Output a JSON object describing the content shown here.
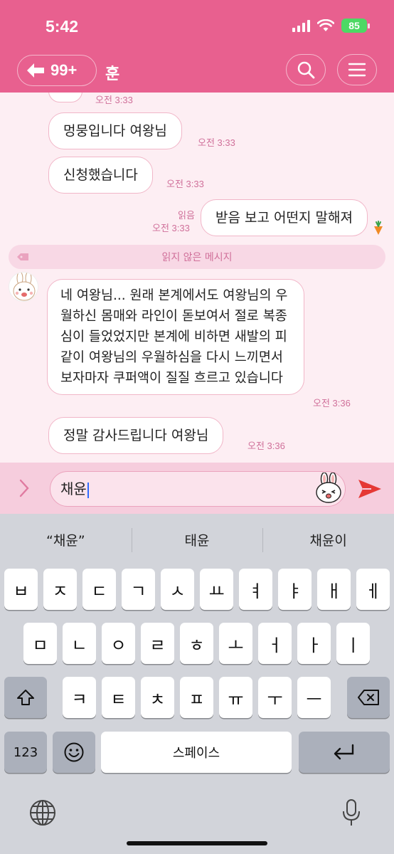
{
  "status": {
    "time": "5:42",
    "battery": "85"
  },
  "header": {
    "back_count": "99+",
    "title": "훈"
  },
  "messages": [
    {
      "text": "\"",
      "time": "오전 3:33"
    },
    {
      "text": "멍뭉입니다 여왕님",
      "time": "오전 3:33"
    },
    {
      "text": "신청했습니다",
      "time": "오전 3:33"
    },
    {
      "text": "받음 보고 어떤지 말해져",
      "time": "오전 3:33",
      "read": "읽음",
      "sender": "me"
    },
    {
      "text": "네 여왕님...  원래 본계에서도 여왕님의 우월하신 몸매와 라인이 돋보여서 절로 복종심이 들었었지만 본계에 비하면 새발의 피같이 여왕님의 우월하심을 다시 느끼면서 보자마자 쿠퍼액이 질질 흐르고 있습니다",
      "time": "오전 3:36"
    },
    {
      "text": "정말 감사드립니다 여왕님",
      "time": "오전 3:36"
    }
  ],
  "unread_label": "읽지 않은 메시지",
  "input": {
    "value": "채윤"
  },
  "suggestions": [
    "“채윤”",
    "태윤",
    "채윤이"
  ],
  "keyboard": {
    "row1": [
      "ㅂ",
      "ㅈ",
      "ㄷ",
      "ㄱ",
      "ㅅ",
      "ㅛ",
      "ㅕ",
      "ㅑ",
      "ㅐ",
      "ㅔ"
    ],
    "row2": [
      "ㅁ",
      "ㄴ",
      "ㅇ",
      "ㄹ",
      "ㅎ",
      "ㅗ",
      "ㅓ",
      "ㅏ",
      "ㅣ"
    ],
    "row3": [
      "ㅋ",
      "ㅌ",
      "ㅊ",
      "ㅍ",
      "ㅠ",
      "ㅜ",
      "ㅡ"
    ],
    "numbers_label": "123",
    "space_label": "스페이스"
  },
  "colors": {
    "header": "#e8608f",
    "chat_bg": "#fdeef3",
    "timestamp": "#d0709a",
    "send": "#e53935"
  }
}
